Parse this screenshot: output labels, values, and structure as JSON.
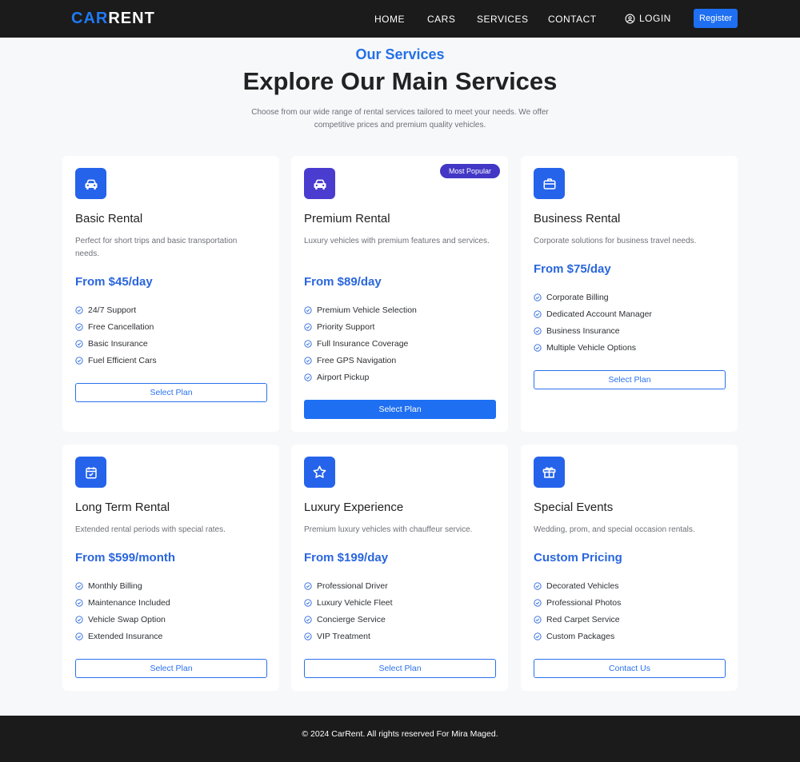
{
  "colors": {
    "accent": "#2470e6",
    "button_primary": "#1e6ff2",
    "icon_blue": "#2563eb",
    "icon_indigo": "#4a3ccf",
    "badge_purple": "#4337c6",
    "navbar_bg": "#1b1b1c"
  },
  "nav": {
    "logo_accent": "CAR",
    "logo_rest": "RENT",
    "links": [
      "HOME",
      "CARS",
      "SERVICES",
      "CONTACT"
    ],
    "login_label": "LOGIN",
    "register_label": "Register"
  },
  "hero": {
    "eyebrow": "Our Services",
    "title": "Explore Our Main Services",
    "description": "Choose from our wide range of rental services tailored to meet your needs. We offer competitive prices and premium quality vehicles."
  },
  "cards": [
    {
      "icon": "car-icon",
      "title": "Basic Rental",
      "description": "Perfect for short trips and basic transportation needs.",
      "price": "From $45/day",
      "features": [
        "24/7 Support",
        "Free Cancellation",
        "Basic Insurance",
        "Fuel Efficient Cars"
      ],
      "button": "Select Plan"
    },
    {
      "icon": "car-icon",
      "badge": "Most Popular",
      "title": "Premium Rental",
      "description": "Luxury vehicles with premium features and services.",
      "price": "From $89/day",
      "features": [
        "Premium Vehicle Selection",
        "Priority Support",
        "Full Insurance Coverage",
        "Free GPS Navigation",
        "Airport Pickup"
      ],
      "button": "Select Plan"
    },
    {
      "icon": "briefcase-icon",
      "title": "Business Rental",
      "description": "Corporate solutions for business travel needs.",
      "price": "From $75/day",
      "features": [
        "Corporate Billing",
        "Dedicated Account Manager",
        "Business Insurance",
        "Multiple Vehicle Options"
      ],
      "button": "Select Plan"
    },
    {
      "icon": "calendar-check-icon",
      "title": "Long Term Rental",
      "description": "Extended rental periods with special rates.",
      "price": "From $599/month",
      "features": [
        "Monthly Billing",
        "Maintenance Included",
        "Vehicle Swap Option",
        "Extended Insurance"
      ],
      "button": "Select Plan"
    },
    {
      "icon": "star-icon",
      "title": "Luxury Experience",
      "description": "Premium luxury vehicles with chauffeur service.",
      "price": "From $199/day",
      "features": [
        "Professional Driver",
        "Luxury Vehicle Fleet",
        "Concierge Service",
        "VIP Treatment"
      ],
      "button": "Select Plan"
    },
    {
      "icon": "gift-icon",
      "title": "Special Events",
      "description": "Wedding, prom, and special occasion rentals.",
      "price": "Custom Pricing",
      "features": [
        "Decorated Vehicles",
        "Professional Photos",
        "Red Carpet Service",
        "Custom Packages"
      ],
      "button": "Contact Us"
    }
  ],
  "footer": {
    "copyright": "© 2024 CarRent. All rights reserved For Mira Maged."
  }
}
